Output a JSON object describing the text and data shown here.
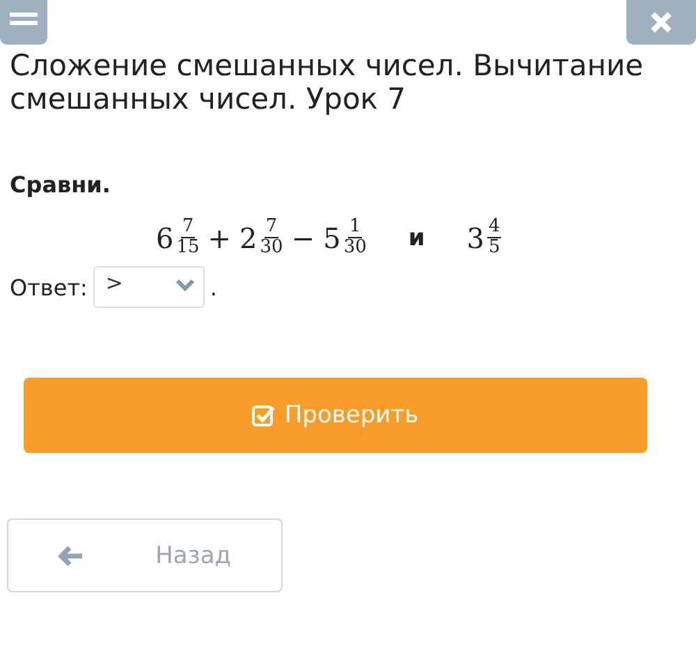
{
  "title": "Сложение смешанных чисел. Вычитание смешанных чисел. Урок 7",
  "task": {
    "prompt": "Сравни.",
    "left": [
      {
        "kind": "mixed",
        "whole": "6",
        "numerator": "7",
        "denominator": "15"
      },
      {
        "kind": "operator",
        "text": "+"
      },
      {
        "kind": "mixed",
        "whole": "2",
        "numerator": "7",
        "denominator": "30"
      },
      {
        "kind": "operator",
        "text": "−"
      },
      {
        "kind": "mixed",
        "whole": "5",
        "numerator": "1",
        "denominator": "30"
      }
    ],
    "conjunction": "и",
    "right": [
      {
        "kind": "mixed",
        "whole": "3",
        "numerator": "4",
        "denominator": "5"
      }
    ]
  },
  "answer": {
    "label": "Ответ:",
    "value": ">",
    "after": "."
  },
  "check_button": "Проверить",
  "back_button": "Назад"
}
